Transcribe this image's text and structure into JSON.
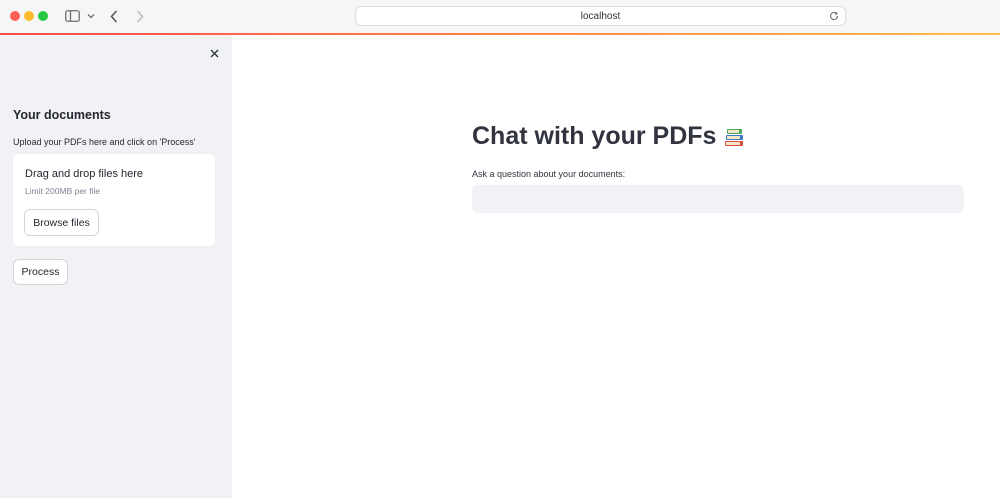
{
  "browser": {
    "url": "localhost"
  },
  "sidebar": {
    "heading": "Your documents",
    "upload_label": "Upload your PDFs here and click on 'Process'",
    "dropzone": {
      "title": "Drag and drop files here",
      "limit": "Limit 200MB per file",
      "browse_label": "Browse files"
    },
    "process_label": "Process"
  },
  "main": {
    "title": "Chat with your PDFs",
    "question_label": "Ask a question about your documents:",
    "question_value": ""
  },
  "colors": {
    "accent_start": "#ff4b4b",
    "accent_end": "#ffbd45",
    "sidebar_bg": "#f0f2f6"
  }
}
